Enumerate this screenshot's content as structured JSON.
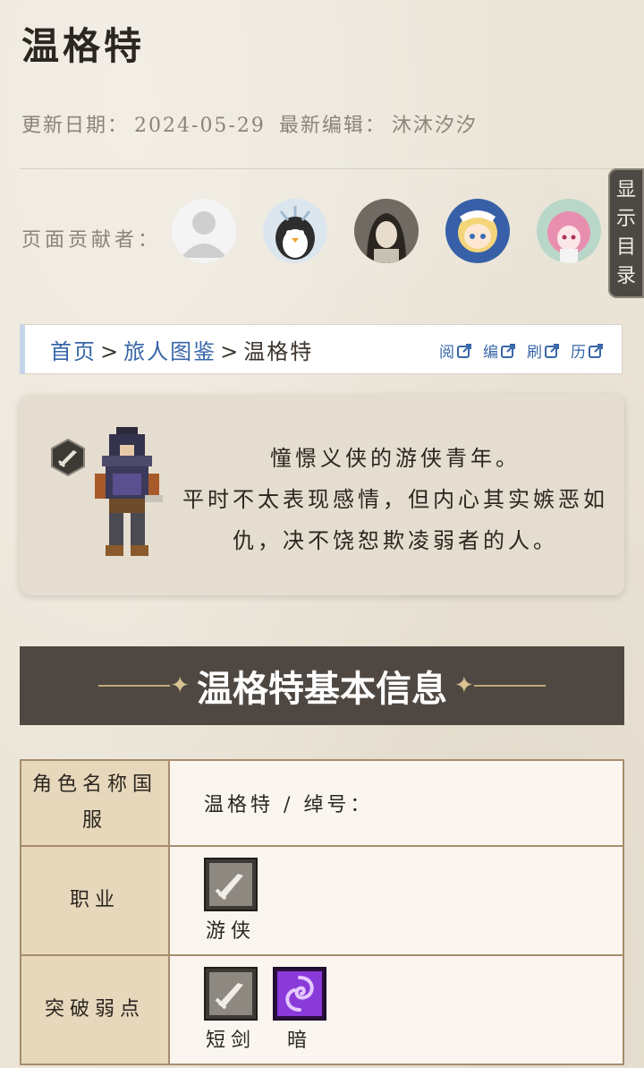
{
  "page": {
    "title": "温格特",
    "meta": {
      "update_label": "更新日期：",
      "update_date": "2024-05-29",
      "editor_label": "最新编辑：",
      "editor": "沐沐汐汐"
    },
    "contributors_label": "页面贡献者：",
    "toc_toggle": [
      "显",
      "示",
      "目",
      "录"
    ]
  },
  "breadcrumb": {
    "home": "首页",
    "sep1": ">",
    "section": "旅人图鉴",
    "sep2": ">",
    "current": "温格特",
    "tools": [
      {
        "label": "阅"
      },
      {
        "label": "编"
      },
      {
        "label": "刷"
      },
      {
        "label": "历"
      }
    ]
  },
  "intro": {
    "line1": "憧憬义侠的游侠青年。",
    "line2": "平时不太表现感情，但内心其实嫉恶如",
    "line3": "仇，决不饶恕欺凌弱者的人。"
  },
  "section": {
    "title": "温格特基本信息",
    "star": "✦"
  },
  "info_table": {
    "name_label": "角色名称国服",
    "name_value": "温格特 / 绰号：",
    "job_label": "职业",
    "job_value": "游侠",
    "weak_label": "突破弱点",
    "weaknesses": [
      "短剑",
      "暗"
    ]
  },
  "colors": {
    "banner": "#4f4842",
    "link": "#3766a8",
    "header_cell": "#e7d7bb",
    "dark_element": "#8a3ad9"
  }
}
